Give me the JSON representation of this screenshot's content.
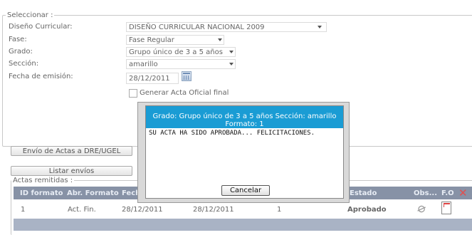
{
  "form": {
    "legend": "Seleccionar :",
    "fields": [
      {
        "label": "Diseño Curricular:",
        "value": "DISEÑO CURRICULAR NACIONAL 2009"
      },
      {
        "label": "Fase:",
        "value": "Fase Regular"
      },
      {
        "label": "Grado:",
        "value": "Grupo único de 3 a 5 años"
      },
      {
        "label": "Sección:",
        "value": "amarillo"
      }
    ],
    "date_label": "Fecha de emisión:",
    "date_value": "28/12/2011",
    "checkbox_label": "Generar Acta Oficial final"
  },
  "buttons": {
    "send": "Envío de Actas a DRE/UGEL",
    "list": "Listar envíos"
  },
  "grid": {
    "legend": "Actas remitidas :",
    "columns": [
      "ID formato",
      "Abr. Formato",
      "Fecha",
      "Estado",
      "Obs...",
      "F.O"
    ],
    "row": {
      "id": "1",
      "abr": "Act. Fin.",
      "fecha": "28/12/2011",
      "fecha2": "28/12/2011",
      "num": "1",
      "estado": "Aprobado"
    }
  },
  "dialog": {
    "title_line1": "Grado: Grupo único de 3 a 5 años Sección: amarillo",
    "title_line2": "Formato: 1",
    "message": "SU ACTA HA SIDO APROBADA... FELICITACIONES.",
    "cancel_label": "Cancelar"
  },
  "colors": {
    "dialog_header": "#1a9cd4",
    "grid_header": "#8792a6",
    "grid_footer": "#a9b3c5"
  }
}
